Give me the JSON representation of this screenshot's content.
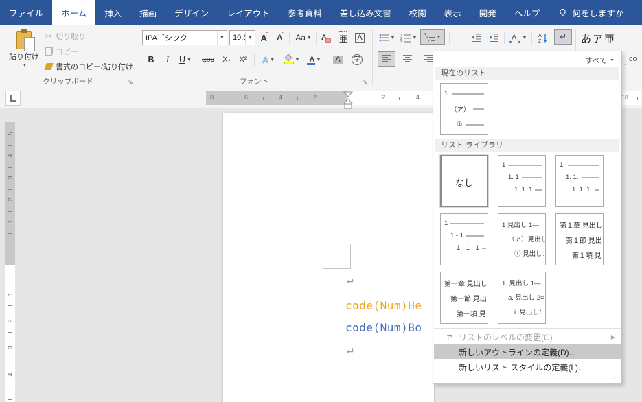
{
  "tabs": {
    "items": [
      {
        "id": "file",
        "label": "ファイル",
        "active": false
      },
      {
        "id": "home",
        "label": "ホーム",
        "active": true
      },
      {
        "id": "insert",
        "label": "挿入",
        "active": false
      },
      {
        "id": "draw",
        "label": "描画",
        "active": false
      },
      {
        "id": "design",
        "label": "デザイン",
        "active": false
      },
      {
        "id": "layout",
        "label": "レイアウト",
        "active": false
      },
      {
        "id": "references",
        "label": "参考資料",
        "active": false
      },
      {
        "id": "mailings",
        "label": "差し込み文書",
        "active": false
      },
      {
        "id": "review",
        "label": "校閲",
        "active": false
      },
      {
        "id": "view",
        "label": "表示",
        "active": false
      },
      {
        "id": "developer",
        "label": "開発",
        "active": false
      },
      {
        "id": "help",
        "label": "ヘルプ",
        "active": false
      }
    ],
    "assistant": "何をしますか"
  },
  "ribbon": {
    "clipboard": {
      "group_label": "クリップボード",
      "paste": "貼り付け",
      "cut": "切り取り",
      "copy": "コピー",
      "format_painter": "書式のコピー/貼り付け"
    },
    "font": {
      "group_label": "フォント",
      "font_name": "IPAゴシック",
      "font_size": "10.5",
      "bold": "B",
      "italic": "I",
      "underline": "U",
      "strike": "abc",
      "subscript": "X₂",
      "superscript": "X²",
      "grow": "A",
      "shrink": "A",
      "case": "Aa",
      "clear": "A",
      "ruby": "亜",
      "enclose": "A",
      "effects": "A",
      "color": "A",
      "shading": "A",
      "enclose_char": "字"
    },
    "styles": {
      "preview": "あア亜",
      "fragment_ellipsis": "…",
      "fragment_name": "co"
    }
  },
  "dropdown": {
    "filter": "すべて",
    "current_list_header": "現在のリスト",
    "current_list": {
      "lines": [
        {
          "t": "1.",
          "rule": true
        },
        {
          "t": "（ア）",
          "rule": true
        },
        {
          "t": "①",
          "rule": true
        }
      ]
    },
    "library_header": "リスト ライブラリ",
    "gallery": [
      {
        "kind": "none",
        "label": "なし",
        "selected": true
      },
      {
        "kind": "list",
        "lines": [
          {
            "t": "1",
            "rule": true
          },
          {
            "t": "1. 1",
            "rule": true
          },
          {
            "t": "1. 1. 1",
            "rule": true
          }
        ]
      },
      {
        "kind": "list",
        "lines": [
          {
            "t": "1.",
            "rule": true
          },
          {
            "t": "1. 1.",
            "rule": true
          },
          {
            "t": "1. 1. 1.",
            "rule": true
          }
        ]
      },
      {
        "kind": "list",
        "lines": [
          {
            "t": "1",
            "rule": true
          },
          {
            "t": "1 - 1",
            "rule": true
          },
          {
            "t": "1 - 1 - 1",
            "rule": true
          }
        ]
      },
      {
        "kind": "list",
        "lines": [
          {
            "t": "1 見出し 1—",
            "rule": false
          },
          {
            "t": "（ア）見出し",
            "rule": false
          },
          {
            "t": "① 見出し：",
            "rule": false
          }
        ]
      },
      {
        "kind": "list",
        "kanji": true,
        "lines": [
          {
            "t": "第１章 見出し",
            "rule": false
          },
          {
            "t": "第１節 見出",
            "rule": false
          },
          {
            "t": "第１項 見",
            "rule": false
          }
        ]
      },
      {
        "kind": "list",
        "kanji": true,
        "lines": [
          {
            "t": "第一章 見出し",
            "rule": false
          },
          {
            "t": "第一節 見出",
            "rule": false
          },
          {
            "t": "第一項 見",
            "rule": false
          }
        ]
      },
      {
        "kind": "list",
        "lines": [
          {
            "t": "1. 見出し 1—",
            "rule": false
          },
          {
            "t": "a. 見出し 2=",
            "rule": false
          },
          {
            "t": "i. 見出し：",
            "rule": false
          }
        ]
      }
    ],
    "menu_items": [
      {
        "label": "リストのレベルの変更(C)",
        "disabled": true,
        "has_submenu": true,
        "highlighted": false
      },
      {
        "label": "新しいアウトラインの定義(D)...",
        "disabled": false,
        "has_submenu": false,
        "highlighted": true
      },
      {
        "label": "新しいリスト スタイルの定義(L)...",
        "disabled": false,
        "has_submenu": false,
        "highlighted": false
      }
    ]
  },
  "ruler": {
    "h_gray": [
      "8",
      "6",
      "4",
      "2"
    ],
    "h_white": [
      "2",
      "4"
    ],
    "h_far": "18",
    "v_gray": [
      "5",
      "4",
      "3",
      "2",
      "1"
    ],
    "v_white": [
      "1",
      "2",
      "3",
      "4"
    ]
  },
  "document": {
    "para_mark": "↵",
    "line1": "code(Num)He",
    "line2": "code(Num)Bo",
    "line1_color": "#EFA51F",
    "line2_color": "#4370C4"
  }
}
